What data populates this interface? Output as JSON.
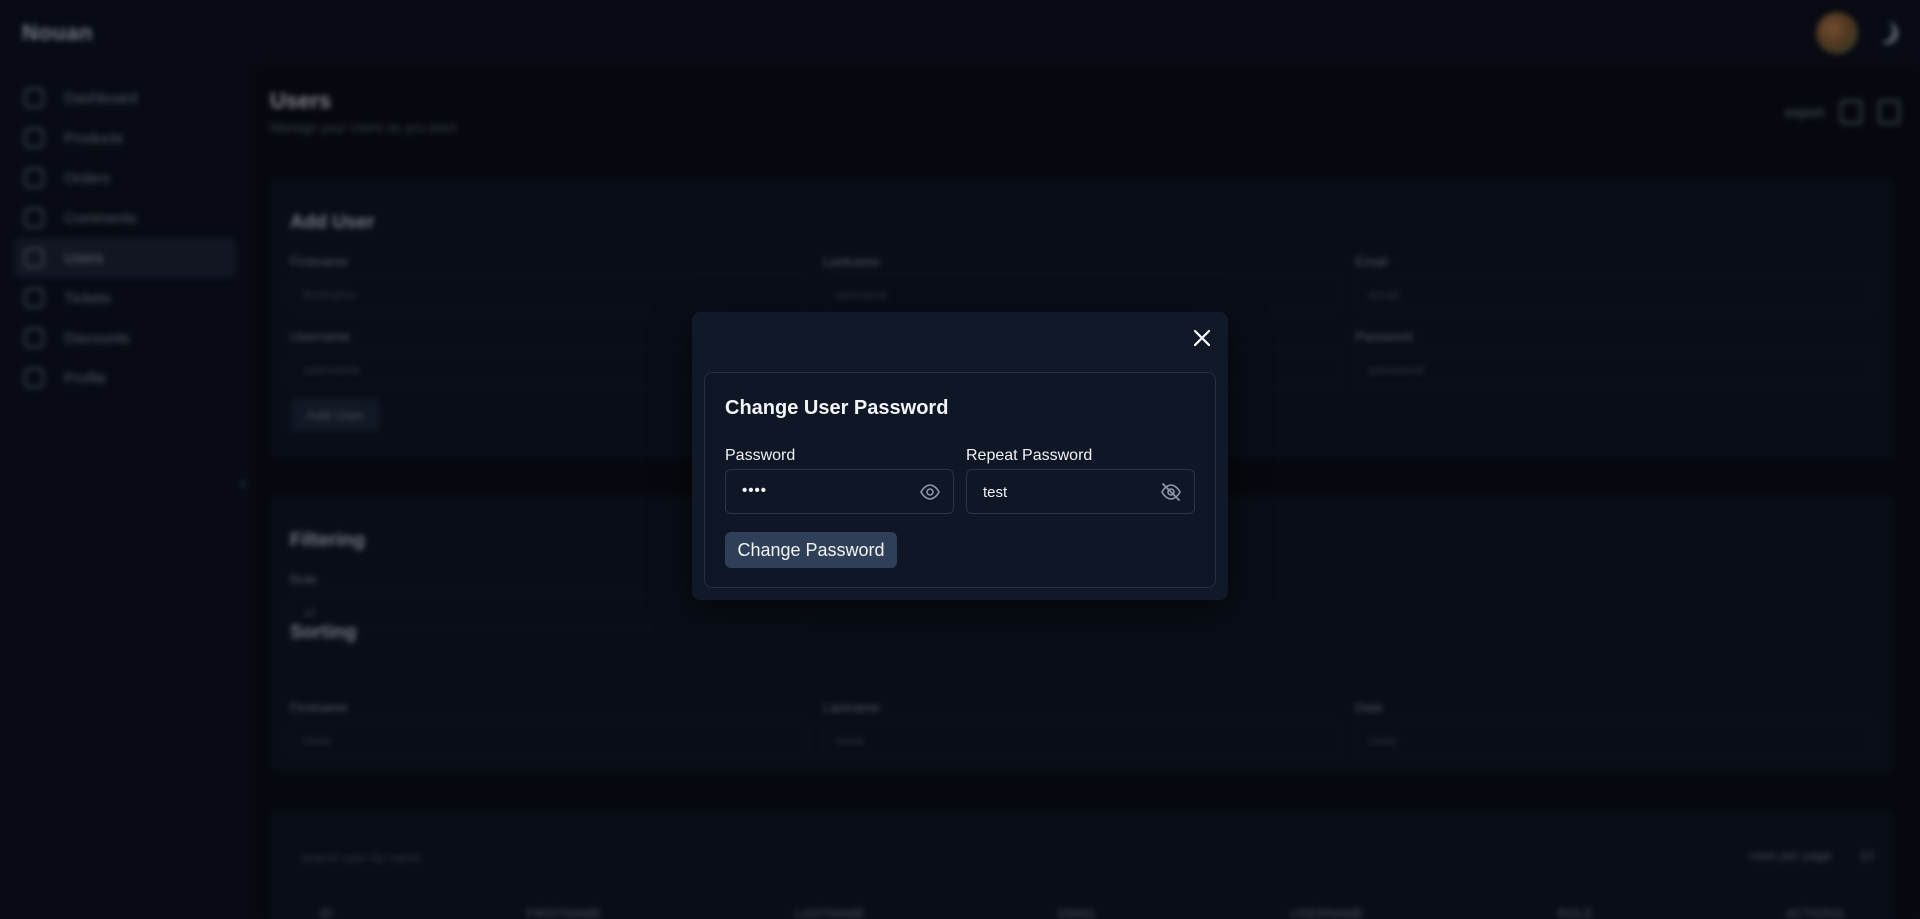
{
  "app": {
    "logo": "Nouan"
  },
  "sidebar": {
    "items": [
      {
        "label": "Dashboard"
      },
      {
        "label": "Products"
      },
      {
        "label": "Orders"
      },
      {
        "label": "Comments"
      },
      {
        "label": "Users"
      },
      {
        "label": "Tickets"
      },
      {
        "label": "Discounts"
      },
      {
        "label": "Profile"
      }
    ]
  },
  "page": {
    "title": "Users",
    "subtitle": "Manage your Users as you want",
    "export_label": "export"
  },
  "add_user": {
    "title": "Add User",
    "fields": [
      {
        "label": "Firstname",
        "placeholder": "firstname"
      },
      {
        "label": "Lastname",
        "placeholder": "lastname"
      },
      {
        "label": "Email",
        "placeholder": "email"
      },
      {
        "label": "Username",
        "placeholder": "username"
      },
      {
        "label": "",
        "placeholder": ""
      },
      {
        "label": "Password",
        "placeholder": "password"
      }
    ],
    "button": "Add User"
  },
  "filtering": {
    "title": "Filtering",
    "role_label": "Role",
    "role_value": "all"
  },
  "sorting": {
    "title": "Sorting",
    "fields": [
      {
        "label": "Firstname",
        "value": "none"
      },
      {
        "label": "Lastname",
        "value": "none"
      },
      {
        "label": "Date",
        "value": "none"
      }
    ]
  },
  "table": {
    "search_placeholder": "search user by name",
    "rows_per_page_label": "rows per page",
    "rows_per_page_value": "10",
    "headers": [
      "ID",
      "FIRSTNAME",
      "LASTNAME",
      "EMAIL",
      "USERNAME",
      "ROLE",
      "ACTIONS"
    ]
  },
  "modal": {
    "title": "Change User Password",
    "password_label": "Password",
    "password_value": "••••",
    "repeat_label": "Repeat Password",
    "repeat_value": "test",
    "submit_label": "Change Password"
  }
}
